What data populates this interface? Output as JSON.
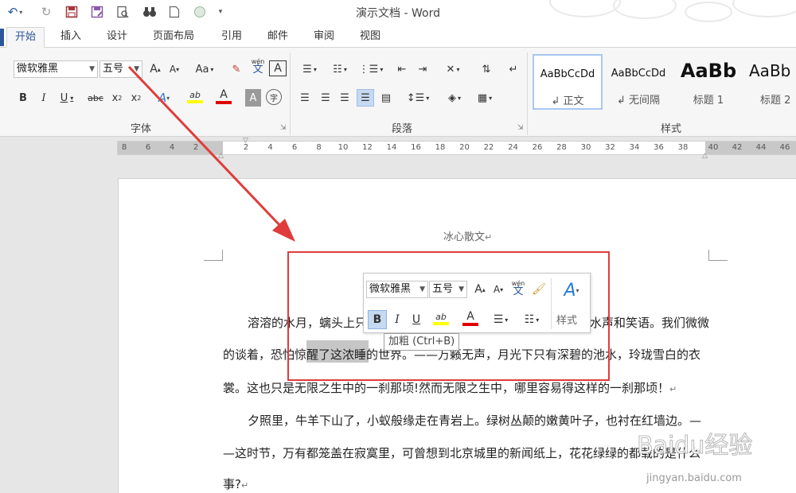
{
  "window": {
    "title": "演示文档 - Word"
  },
  "quick_access": [
    "undo-icon",
    "redo-icon",
    "save-icon",
    "save-as-icon",
    "print-preview-icon",
    "find-icon",
    "new-doc-icon",
    "circle-icon",
    "customize-icon"
  ],
  "tabs": [
    {
      "label": "开始",
      "active": true
    },
    {
      "label": "插入"
    },
    {
      "label": "设计"
    },
    {
      "label": "页面布局"
    },
    {
      "label": "引用"
    },
    {
      "label": "邮件"
    },
    {
      "label": "审阅"
    },
    {
      "label": "视图"
    }
  ],
  "ribbon": {
    "font": {
      "name": "微软雅黑",
      "size": "五号",
      "group_label": "字体",
      "grow_label": "A",
      "shrink_label": "A",
      "case_label": "Aa",
      "phonetic_top": "wén",
      "phonetic_char": "文",
      "border_char": "A",
      "bold": "B",
      "italic": "I",
      "underline": "U",
      "strike": "abc",
      "sub": "x",
      "sub2": "2",
      "sup": "x",
      "sup2": "2",
      "highlight_label": "ab",
      "color_label": "A",
      "shade_label": "A",
      "circle_char": "字"
    },
    "paragraph": {
      "group_label": "段落"
    },
    "styles": {
      "group_label": "样式",
      "items": [
        {
          "sample": "AaBbCcDd",
          "name": "↲ 正文"
        },
        {
          "sample": "AaBbCcDd",
          "name": "↲ 无间隔"
        },
        {
          "sample": "AaBb",
          "name": "标题 1"
        },
        {
          "sample": "AaBb",
          "name": "标题 2"
        }
      ]
    }
  },
  "ruler": {
    "left_ticks": [
      "8",
      "6",
      "4",
      "2"
    ],
    "ticks": [
      "2",
      "4",
      "6",
      "8",
      "10",
      "12",
      "14",
      "16",
      "18",
      "20",
      "22",
      "24",
      "26",
      "28",
      "30",
      "32",
      "34",
      "36",
      "38"
    ],
    "right_ticks": [
      "40",
      "42",
      "44",
      "46"
    ]
  },
  "document": {
    "header": "冰心散文",
    "lines": [
      "溶溶的水月，螭头上只",
      "水声和笑语。我们微微",
      "的谈着，恐怕惊醒了这浓睡的世界。——万籁无声，月光下只有深碧的池水，玲珑雪白的衣",
      "裳。这也只是无限之生中的一刹那顷!然而无限之生中，哪里容易得这样的一刹那顷！",
      "夕照里，牛羊下山了，小蚁般缘走在青岩上。绿树丛颠的嫩黄叶子，也衬在红墙边。—",
      "—这时节，万有都笼盖在寂寞里，可曾想到北京城里的新闻纸上，花花绿绿的都载的是什么",
      "事?"
    ],
    "para_mark": "↵"
  },
  "mini_toolbar": {
    "font": "微软雅黑",
    "size": "五号",
    "bold": "B",
    "italic": "I",
    "underline": "U",
    "highlight_label": "ab",
    "color_label": "A",
    "grow_label": "A",
    "shrink_label": "A",
    "phonetic_top": "wén",
    "phonetic_char": "文",
    "styles_label": "样式",
    "tooltip": "加粗 (Ctrl+B)"
  },
  "watermark": {
    "logo": "Baidu经验",
    "url": "jingyan.baidu.com"
  },
  "colors": {
    "accent": "#2b579a",
    "annotation": "#e03c3c",
    "highlight_yellow": "#ffff00",
    "font_red": "#e00000",
    "selection": "#c6c6c6"
  }
}
